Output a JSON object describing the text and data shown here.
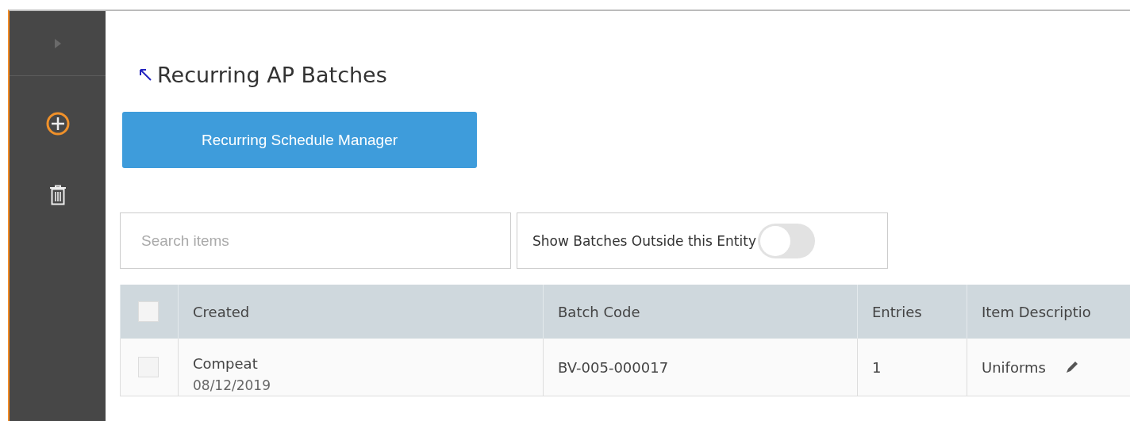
{
  "sidebar": {
    "items": [
      {
        "kind": "expand"
      },
      {
        "kind": "add"
      },
      {
        "kind": "delete"
      }
    ]
  },
  "page": {
    "title": "Recurring AP Batches",
    "button": "Recurring Schedule Manager"
  },
  "search": {
    "placeholder": "Search items"
  },
  "toggle": {
    "label": "Show Batches Outside this Entity",
    "on": false
  },
  "table": {
    "header_checked": false,
    "columns": [
      "Created",
      "Batch Code",
      "Entries",
      "Item Descriptio"
    ],
    "rows": [
      {
        "checked": false,
        "created_by": "Compeat",
        "created_date": "08/12/2019",
        "batch_code": "BV-005-000017",
        "entries": "1",
        "item_description": "Uniforms"
      }
    ]
  }
}
